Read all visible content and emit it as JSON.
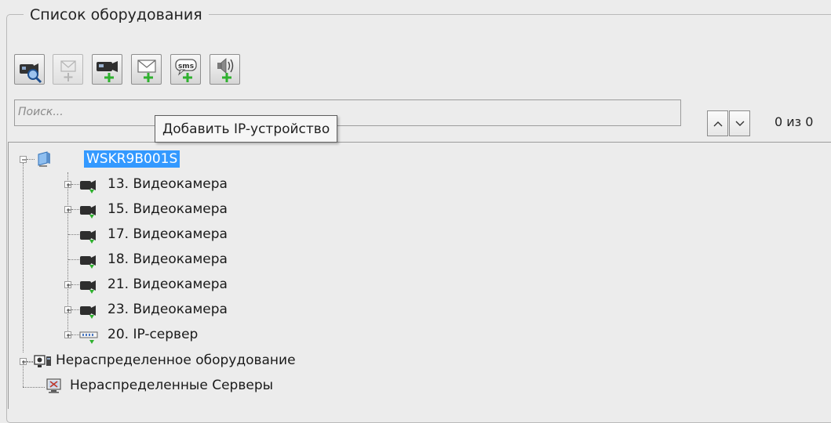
{
  "group": {
    "title": "Список оборудования"
  },
  "toolbar": {
    "buttons": [
      {
        "name": "search-camera-button",
        "icon": "camera-search-icon",
        "enabled": true
      },
      {
        "name": "add-mail-server-button",
        "icon": "envelope-add-icon",
        "enabled": false
      },
      {
        "name": "add-ip-device-button",
        "icon": "camera-add-icon",
        "enabled": true
      },
      {
        "name": "add-mail-button",
        "icon": "envelope-add-icon",
        "enabled": true
      },
      {
        "name": "add-sms-button",
        "icon": "sms-add-icon",
        "enabled": true
      },
      {
        "name": "add-sound-button",
        "icon": "speaker-add-icon",
        "enabled": true
      }
    ]
  },
  "search": {
    "placeholder": "Поиск...",
    "counter": "0 из 0"
  },
  "tooltip": {
    "text": "Добавить IP-устройство"
  },
  "tree": {
    "root": {
      "label": "WSKR9B001S",
      "icon": "computer-icon",
      "selected": true
    },
    "children": [
      {
        "label": "13. Видеокамера",
        "icon": "camera-icon",
        "expandable": true
      },
      {
        "label": "15. Видеокамера",
        "icon": "camera-icon",
        "expandable": true
      },
      {
        "label": "17. Видеокамера",
        "icon": "camera-icon",
        "expandable": false
      },
      {
        "label": "18. Видеокамера",
        "icon": "camera-icon",
        "expandable": false
      },
      {
        "label": "21. Видеокамера",
        "icon": "camera-icon",
        "expandable": true
      },
      {
        "label": "23. Видеокамера",
        "icon": "camera-icon",
        "expandable": true
      },
      {
        "label": "20. IP-сервер",
        "icon": "ip-server-icon",
        "expandable": true
      }
    ],
    "unassigned_equipment": {
      "label": "Нераспределенное оборудование",
      "icon": "equipment-icon",
      "expandable": true
    },
    "unassigned_servers": {
      "label": "Нераспределенные Серверы",
      "icon": "server-monitor-icon",
      "expandable": false
    }
  },
  "colors": {
    "selection": "#3399ff",
    "accent_green": "#2fb12f",
    "panel": "#ececec"
  }
}
